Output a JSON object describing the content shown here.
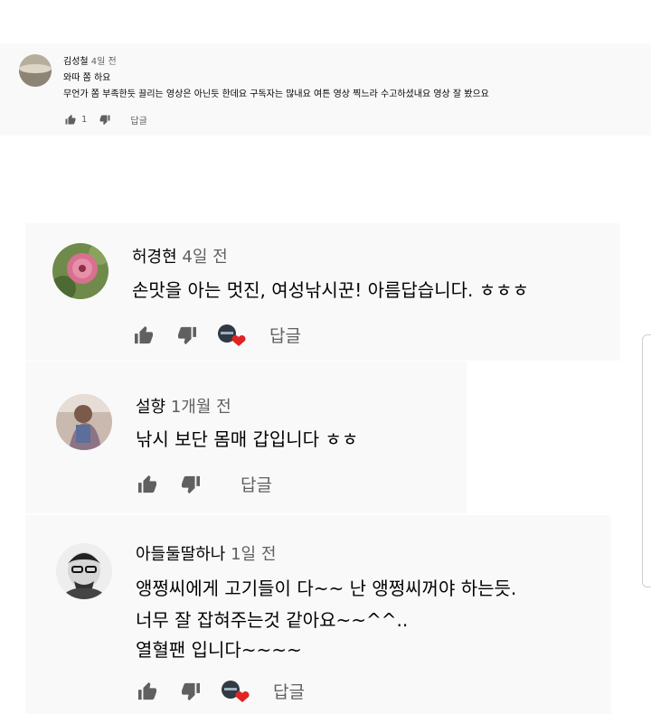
{
  "comments": [
    {
      "author": "김성철",
      "time": "4일 전",
      "lines": [
        "와따 쫌 하요",
        "무언가 쫌 부족한듯 끌리는 영상은 아닌듯 한데요  구독자는 많내요  여튼 영상 찍느라 수고하셨내요 영상 잘 봤으요"
      ],
      "like_count": "1",
      "reply_label": "답글",
      "creator_heart": false
    },
    {
      "author": "허경현",
      "time": "4일 전",
      "lines": [
        "손맛을 아는 멋진, 여성낚시꾼! 아름답습니다. ㅎㅎㅎ"
      ],
      "like_count": "",
      "reply_label": "답글",
      "creator_heart": true
    },
    {
      "author": "설향",
      "time": "1개월 전",
      "lines": [
        "낚시 보단 몸매 갑입니다 ㅎㅎ"
      ],
      "like_count": "",
      "reply_label": "답글",
      "creator_heart": false
    },
    {
      "author": "아들둘딸하나",
      "time": "1일 전",
      "lines": [
        "앵쩡씨에게 고기들이 다~~  난 앵쩡씨꺼야 하는듯.",
        "너무 잘 잡혀주는것 같아요~~^^..",
        "열혈팬 입니다~~~~"
      ],
      "like_count": "",
      "reply_label": "답글",
      "creator_heart": true
    }
  ],
  "colors": {
    "card_background": "#f9f9f9",
    "heart": "#e02424",
    "icon": "#606060"
  }
}
